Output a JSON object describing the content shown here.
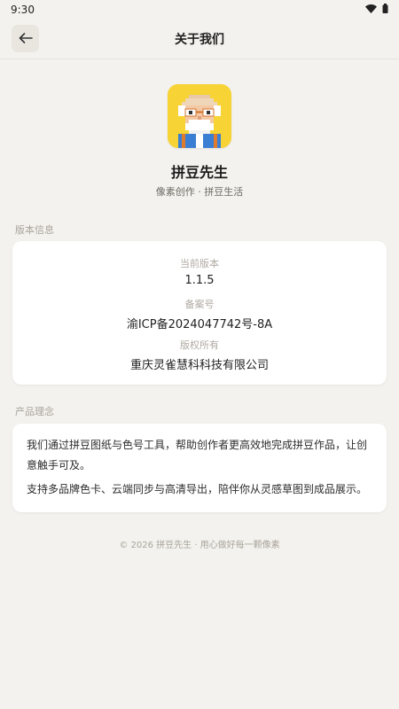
{
  "status": {
    "time": "9:30"
  },
  "header": {
    "title": "关于我们"
  },
  "app": {
    "name": "拼豆先生",
    "slogan": "像素创作 · 拼豆生活"
  },
  "version_section": {
    "label": "版本信息",
    "items": [
      {
        "caption": "当前版本",
        "value": "1.1.5"
      },
      {
        "caption": "备案号",
        "value": "渝ICP备2024047742号-8A"
      },
      {
        "caption": "版权所有",
        "value": "重庆灵雀慧科科技有限公司"
      }
    ]
  },
  "concept_section": {
    "label": "产品理念",
    "paragraphs": [
      "我们通过拼豆图纸与色号工具，帮助创作者更高效地完成拼豆作品，让创意触手可及。",
      "支持多品牌色卡、云端同步与高清导出，陪伴你从灵感草图到成品展示。"
    ]
  },
  "footer": {
    "text": "© 2026 拼豆先生 · 用心做好每一颗像素"
  },
  "colors": {
    "background": "#f4f2ee",
    "icon_bg": "#f7d335",
    "card": "#ffffff"
  },
  "icons": {
    "back": "arrow-left-icon",
    "wifi": "wifi-icon",
    "battery": "battery-icon",
    "app": "pixel-grandpa-icon"
  }
}
